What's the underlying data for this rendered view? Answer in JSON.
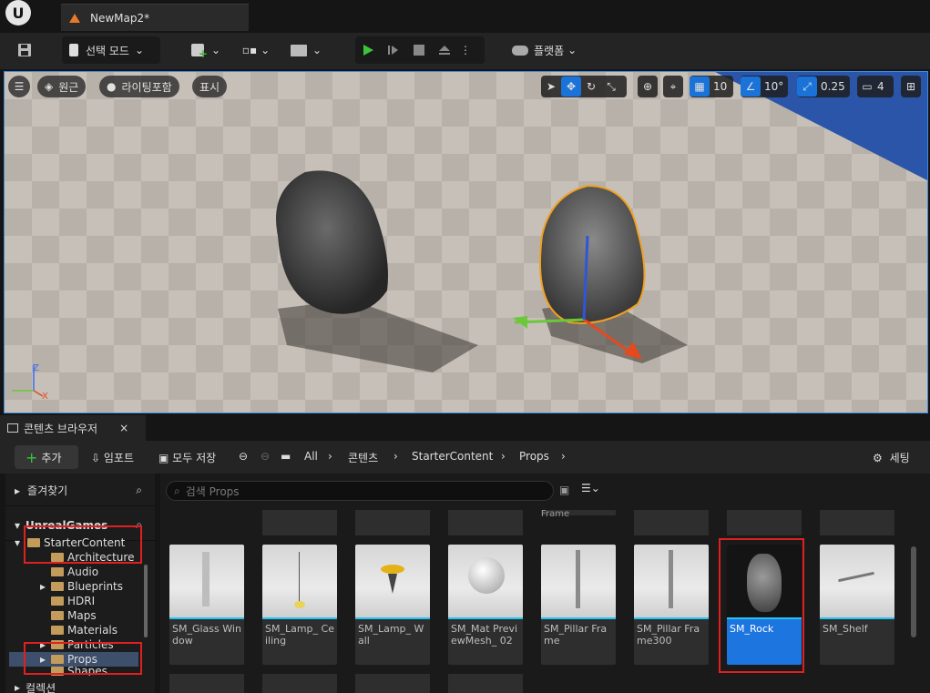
{
  "titlebar": {
    "tab_title": "NewMap2*"
  },
  "toolbar": {
    "mode_label": "선택 모드",
    "platform_label": "플랫폼"
  },
  "viewport": {
    "perspective_label": "원근",
    "lighting_label": "라이팅포함",
    "show_label": "표시",
    "grid_snap_value": "10",
    "rotation_snap_value": "10°",
    "scale_snap_value": "0.25",
    "camera_speed_value": "4",
    "axis_z": "Z",
    "axis_x": "X"
  },
  "content_browser": {
    "tab_label": "콘텐츠 브라우저",
    "add_label": "추가",
    "import_label": "임포트",
    "save_all_label": "모두 저장",
    "breadcrumb": [
      "All",
      "콘텐츠",
      "StarterContent",
      "Props"
    ],
    "settings_label": "세팅",
    "search_placeholder": "검색 Props",
    "favorites_label": "즐겨찾기",
    "project_label": "UnrealGames",
    "collections_label": "컬렉션",
    "tree": [
      "StarterContent",
      "Architecture",
      "Audio",
      "Blueprints",
      "HDRI",
      "Maps",
      "Materials",
      "Particles",
      "Props",
      "Shapes"
    ],
    "partial_tile_label": "Frame",
    "assets": [
      {
        "label": "SM_Glass Window"
      },
      {
        "label": "SM_Lamp_ Ceiling"
      },
      {
        "label": "SM_Lamp_ Wall"
      },
      {
        "label": "SM_Mat PreviewMesh_ 02"
      },
      {
        "label": "SM_Pillar Frame"
      },
      {
        "label": "SM_Pillar Frame300"
      },
      {
        "label": "SM_Rock"
      },
      {
        "label": "SM_Shelf"
      }
    ]
  },
  "colors": {
    "accent": "#1d75e0",
    "highlight_red": "#e02020",
    "asset_bar": "#20c7f4"
  }
}
